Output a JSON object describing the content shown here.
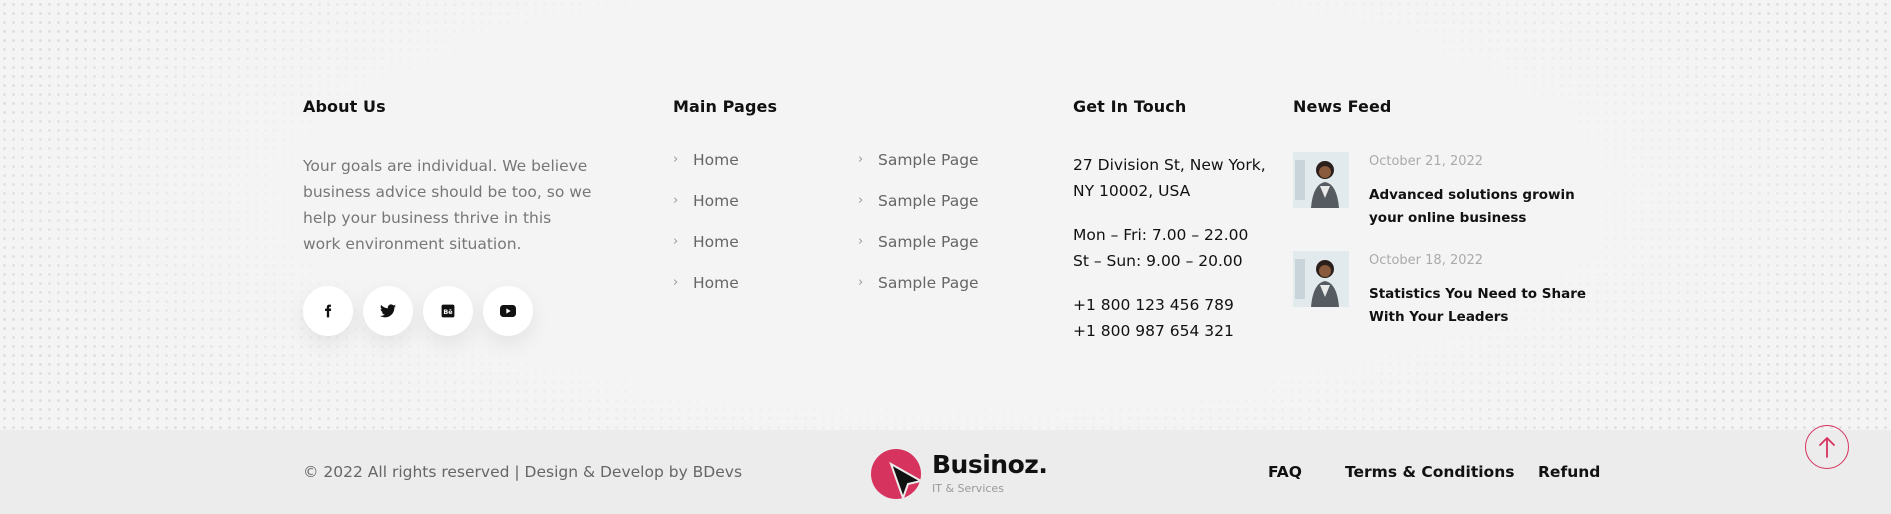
{
  "about": {
    "title": "About Us",
    "text": "Your goals are individual. We believe business advice should be too, so we help your business thrive in this work environment situation.",
    "socials": [
      {
        "name": "facebook-icon"
      },
      {
        "name": "twitter-icon"
      },
      {
        "name": "behance-icon"
      },
      {
        "name": "youtube-icon"
      }
    ]
  },
  "main_pages": {
    "title": "Main Pages",
    "col1": [
      "Home",
      "Home",
      "Home",
      "Home"
    ],
    "col2": [
      "Sample Page",
      "Sample Page",
      "Sample Page",
      "Sample Page"
    ]
  },
  "contact": {
    "title": "Get In Touch",
    "address_line1": "27 Division St, New York,",
    "address_line2": "NY 10002, USA",
    "hours_line1": "Mon – Fri: 7.00 – 22.00",
    "hours_line2": "St – Sun: 9.00 – 20.00",
    "phone1": "+1 800 123 456 789",
    "phone2": "+1 800 987 654 321"
  },
  "news": {
    "title": "News Feed",
    "items": [
      {
        "date": "October 21, 2022",
        "title": "Advanced solutions growin your online business"
      },
      {
        "date": "October 18, 2022",
        "title": "Statistics You Need to Share With Your Leaders"
      }
    ]
  },
  "bottom": {
    "copyright": "© 2022 All rights reserved | Design & Develop by BDevs",
    "brand_name": "Businoz.",
    "brand_tagline": "IT & Services",
    "links": [
      "FAQ",
      "Terms & Conditions",
      "Refund"
    ]
  },
  "colors": {
    "accent": "#d6335e",
    "background": "#f4f4f4",
    "bottom_bar": "#ececec"
  },
  "icons": {
    "chevron": "chevron-right-icon",
    "scroll_top": "arrow-up-icon"
  }
}
